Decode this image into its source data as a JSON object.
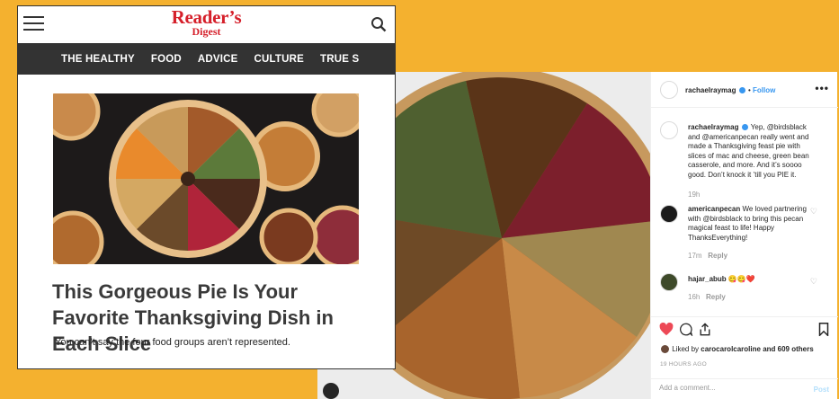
{
  "readers_digest": {
    "logo_line1": "Reader’s",
    "logo_line2": "Digest",
    "nav": [
      "THE HEALTHY",
      "FOOD",
      "ADVICE",
      "CULTURE",
      "TRUE S"
    ],
    "headline": "This Gorgeous Pie Is Your Favorite Thanksgiving Dish in Each Slice",
    "dek": "You can’t say the four food groups aren’t represented.",
    "colors": {
      "brand_red": "#d51f2a",
      "nav_bg": "#333333"
    }
  },
  "instagram": {
    "header": {
      "username": "rachaelraymag",
      "separator": "•",
      "follow_label": "Follow",
      "more": "•••"
    },
    "caption": {
      "username": "rachaelraymag",
      "text": "Yep, @birdsblack and @americanpecan really went and made a Thanksgiving feast pie with slices of mac and cheese, green bean casserole, and more. And it’s soooo good. Don’t knock it ’till you PIE it.",
      "time": "19h"
    },
    "comments": [
      {
        "username": "americanpecan",
        "text": "We loved partnering with @birdsblack to bring this pecan magical feast to life! Happy ThanksEverything!",
        "time": "17m",
        "reply": "Reply"
      },
      {
        "username": "hajar_abub",
        "text": "😋😋❤️",
        "time": "16h",
        "reply": "Reply"
      }
    ],
    "likes_prefix": "Liked by",
    "likes_user": "carocarolcaroline",
    "likes_suffix": "and 609 others",
    "time_ago": "19 HOURS AGO",
    "add_comment_placeholder": "Add a comment...",
    "post_label": "Post",
    "colors": {
      "accent": "#3897f0",
      "like_red": "#ed4956",
      "post_disabled": "#b2dffc"
    }
  },
  "background_color": "#f4b12f"
}
